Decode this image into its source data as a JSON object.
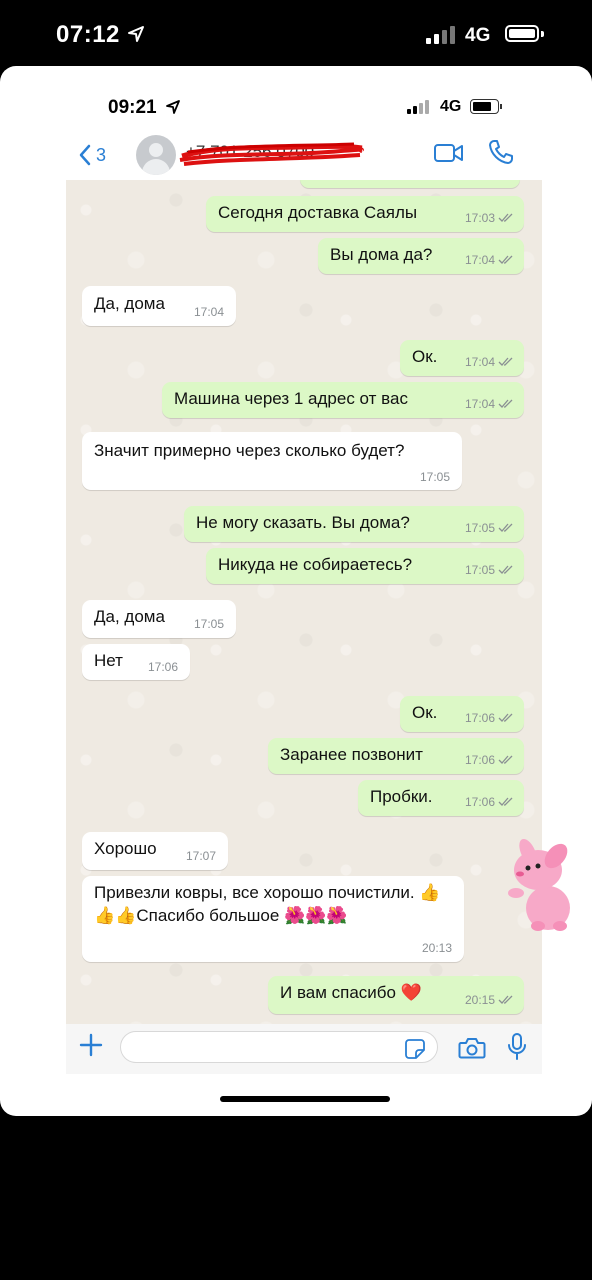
{
  "outer_status": {
    "time": "07:12",
    "network": "4G"
  },
  "inner_status": {
    "time": "09:21",
    "network": "4G"
  },
  "header": {
    "back_count": "3",
    "contact_name": "+7 701 256 0700"
  },
  "composer": {
    "placeholder": ""
  },
  "icons": {
    "back": "chevron-left-icon",
    "video": "video-call-icon",
    "call": "phone-icon",
    "plus": "plus-icon",
    "sticker": "sticker-icon",
    "camera": "camera-icon",
    "mic": "microphone-icon"
  },
  "colors": {
    "accent": "#2a7fd4",
    "outgoing": "#dcf8c6",
    "incoming": "#ffffff",
    "chat_bg": "#efeae2"
  },
  "messages": [
    {
      "dir": "out",
      "text": "Сегодня доставка Саялы",
      "time": "17:03"
    },
    {
      "dir": "out",
      "text": "Вы дома да?",
      "time": "17:04"
    },
    {
      "dir": "in",
      "text": "Да, дома",
      "time": "17:04"
    },
    {
      "dir": "out",
      "text": "Ок.",
      "time": "17:04"
    },
    {
      "dir": "out",
      "text": "Машина через 1 адрес от вас",
      "time": "17:04"
    },
    {
      "dir": "in",
      "text": "Значит примерно через сколько будет?",
      "time": "17:05"
    },
    {
      "dir": "out",
      "text": "Не могу сказать. Вы дома?",
      "time": "17:05"
    },
    {
      "dir": "out",
      "text": "Никуда не собираетесь?",
      "time": "17:05"
    },
    {
      "dir": "in",
      "text": "Да, дома",
      "time": "17:05"
    },
    {
      "dir": "in",
      "text": "Нет",
      "time": "17:06"
    },
    {
      "dir": "out",
      "text": "Ок.",
      "time": "17:06"
    },
    {
      "dir": "out",
      "text": "Заранее позвонит",
      "time": "17:06"
    },
    {
      "dir": "out",
      "text": "Пробки.",
      "time": "17:06"
    },
    {
      "dir": "in",
      "text": "Хорошо",
      "time": "17:07"
    },
    {
      "dir": "in",
      "text": "Привезли ковры, все хорошо почистили. 👍👍👍Спасибо большое 🌺🌺🌺",
      "time": "20:13"
    },
    {
      "dir": "out",
      "text": "И вам спасибо ❤️",
      "time": "20:15"
    }
  ]
}
